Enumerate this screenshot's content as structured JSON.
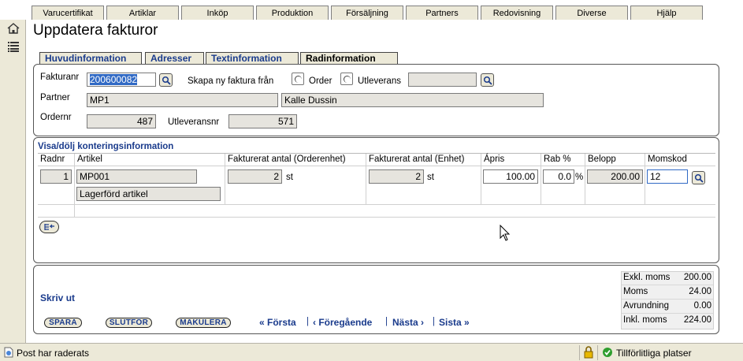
{
  "menu": [
    "Varucertifikat",
    "Artiklar",
    "Inköp",
    "Produktion",
    "Försäljning",
    "Partners",
    "Redovisning",
    "Diverse",
    "Hjälp"
  ],
  "page_title": "Uppdatera fakturor",
  "subtabs": [
    "Huvudinformation",
    "Adresser",
    "Textinformation",
    "Radinformation"
  ],
  "header": {
    "fakturanr_label": "Fakturanr",
    "fakturanr_value": "200600082",
    "skapa_label": "Skapa ny faktura från",
    "order_label": "Order",
    "utleverans_label": "Utleverans",
    "partner_label": "Partner",
    "partner_code": "MP1",
    "partner_name": "Kalle Dussin",
    "ordernr_label": "Ordernr",
    "ordernr_value": "487",
    "utleveransnr_label": "Utleveransnr",
    "utleveransnr_value": "571"
  },
  "rows": {
    "toggle_label": "Visa/dölj konteringsinformation",
    "columns": [
      "Radnr",
      "Artikel",
      "Fakturerat antal (Orderenhet)",
      "Fakturerat antal (Enhet)",
      "Ápris",
      "Rab %",
      "Belopp",
      "Momskod"
    ],
    "row": {
      "radnr": "1",
      "artikel": "MP001",
      "artikel_desc": "Lagerförd artikel",
      "antal_order": "2",
      "antal_order_unit": "st",
      "antal_enhet": "2",
      "antal_enhet_unit": "st",
      "apris": "100.00",
      "rab": "0.0",
      "rab_unit": "%",
      "belopp": "200.00",
      "momskod": "12"
    }
  },
  "footer": {
    "print_label": "Skriv ut",
    "buttons": [
      "SPARA",
      "SLUTFÖR",
      "MAKULERA"
    ],
    "nav": [
      "« Första",
      "‹ Föregående",
      "Nästa ›",
      "Sista »"
    ],
    "totals": [
      {
        "label": "Exkl. moms",
        "value": "200.00"
      },
      {
        "label": "Moms",
        "value": "24.00"
      },
      {
        "label": "Avrundning",
        "value": "0.00"
      },
      {
        "label": "Inkl. moms",
        "value": "224.00"
      }
    ]
  },
  "status": {
    "message": "Post har raderats",
    "zone": "Tillförlitliga platser"
  },
  "colors": {
    "link": "#1a3b8c",
    "tab_bg": "#ece9d8",
    "selection": "#316ac5"
  }
}
